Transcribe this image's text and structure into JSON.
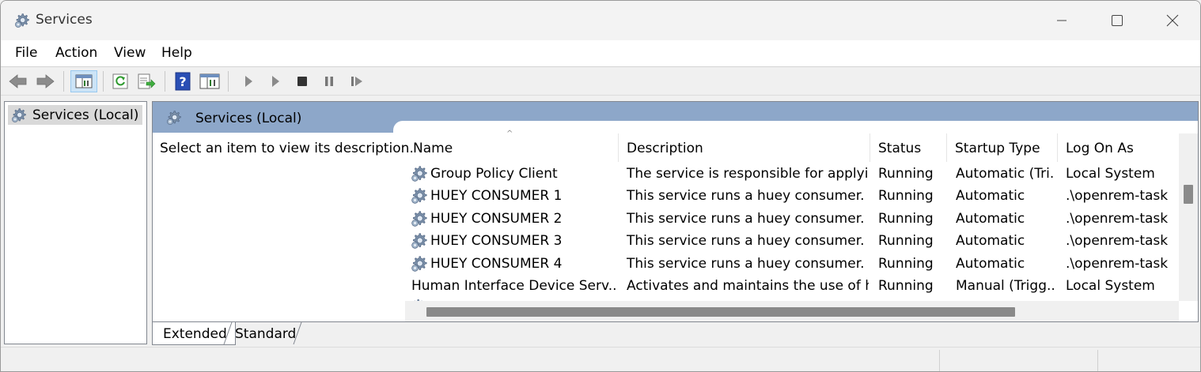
{
  "window": {
    "title": "Services",
    "controls": {
      "minimize_icon": "minimize-icon",
      "maximize_icon": "maximize-icon",
      "close_icon": "close-icon"
    }
  },
  "menu": {
    "items": [
      "File",
      "Action",
      "View",
      "Help"
    ]
  },
  "toolbar": {
    "buttons": [
      "back",
      "forward",
      "show-hide-console-tree",
      "refresh",
      "export-list",
      "help",
      "properties",
      "start-service",
      "start-service-params",
      "stop-service",
      "pause-service",
      "restart-service"
    ]
  },
  "tree": {
    "root_label": "Services (Local)"
  },
  "pane": {
    "header_title": "Services (Local)",
    "description_prompt": "Select an item to view its description."
  },
  "columns": [
    "Name",
    "Description",
    "Status",
    "Startup Type",
    "Log On As"
  ],
  "services": [
    {
      "name": "Group Policy Client",
      "description": "The service is responsible for applyin...",
      "status": "Running",
      "startup_type": "Automatic (Tri...",
      "log_on_as": "Local System"
    },
    {
      "name": "HUEY CONSUMER 1",
      "description": "This service runs a huey consumer.",
      "status": "Running",
      "startup_type": "Automatic",
      "log_on_as": ".\\openrem-task"
    },
    {
      "name": "HUEY CONSUMER 2",
      "description": "This service runs a huey consumer.",
      "status": "Running",
      "startup_type": "Automatic",
      "log_on_as": ".\\openrem-task"
    },
    {
      "name": "HUEY CONSUMER 3",
      "description": "This service runs a huey consumer.",
      "status": "Running",
      "startup_type": "Automatic",
      "log_on_as": ".\\openrem-task"
    },
    {
      "name": "HUEY CONSUMER 4",
      "description": "This service runs a huey consumer.",
      "status": "Running",
      "startup_type": "Automatic",
      "log_on_as": ".\\openrem-task"
    },
    {
      "name": "Human Interface Device Serv...",
      "description": "Activates and maintains the use of h...",
      "status": "Running",
      "startup_type": "Manual (Trigg...",
      "log_on_as": "Local System"
    }
  ],
  "tabs": [
    "Extended",
    "Standard"
  ],
  "colors": {
    "pane_header": "#8da7c9",
    "selection": "#d9d9d9",
    "scroll_thumb": "#8a8a8a"
  }
}
